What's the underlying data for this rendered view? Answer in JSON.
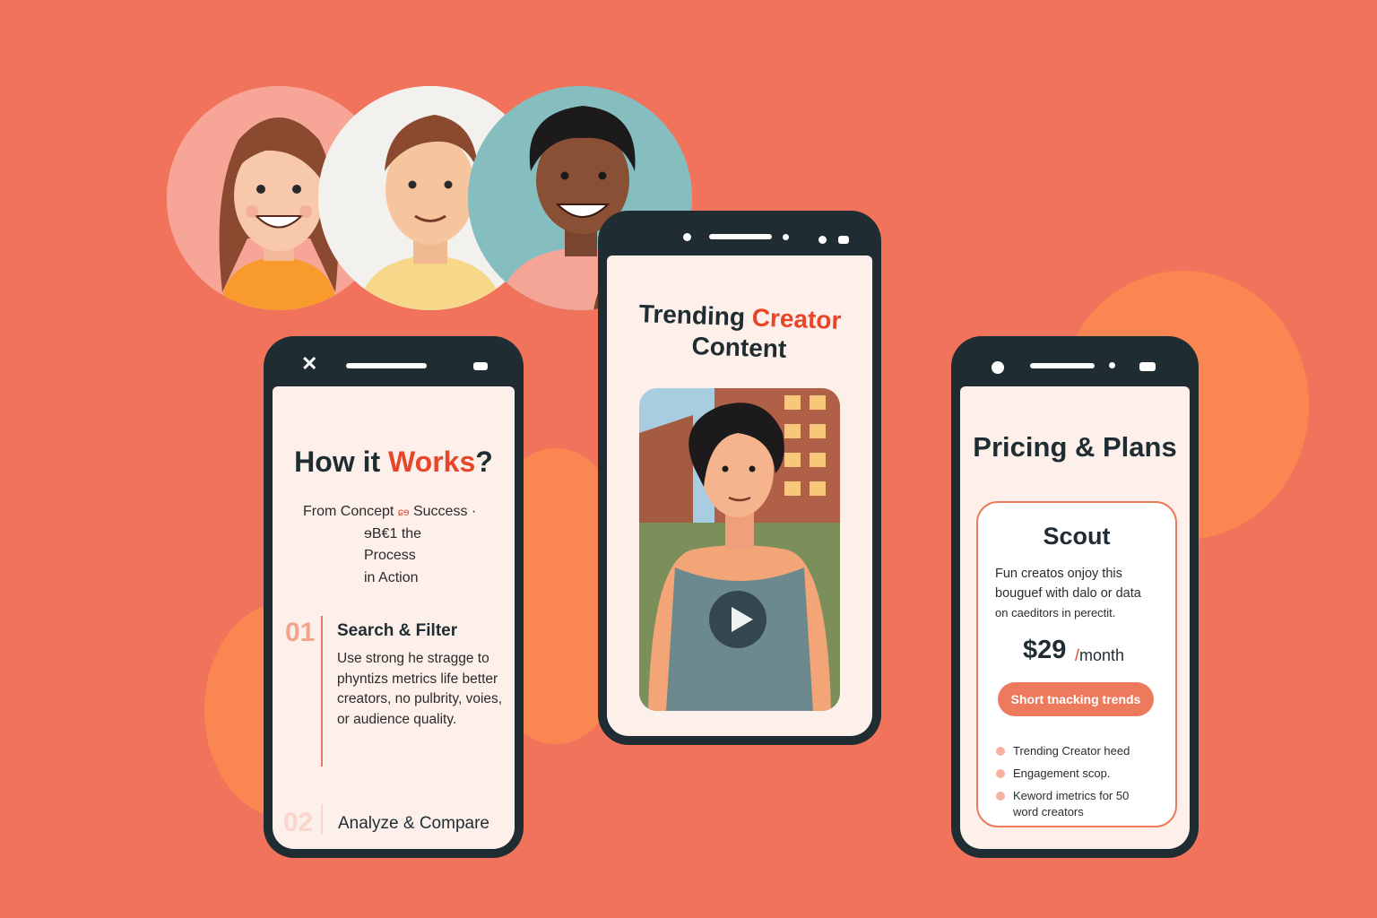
{
  "colors": {
    "background": "#f2735c",
    "accent": "#e8462a",
    "dark": "#1f2d33",
    "button": "#ee7a5e"
  },
  "avatars": [
    {
      "icon": "woman-smiling-avatar"
    },
    {
      "icon": "man-smiling-avatar"
    },
    {
      "icon": "man-curly-hair-avatar"
    }
  ],
  "phone_how": {
    "title_prefix": "How it ",
    "title_accent": "Works",
    "title_suffix": "?",
    "subtitle": [
      "From Concept",
      "Success ·",
      "ɘB€1 the",
      "Process",
      "in Action"
    ],
    "subtitle_mid_glyph": "ɕɘ",
    "steps": [
      {
        "number": "01",
        "title": "Search & Filter",
        "text": "Use strong he stragge to phyntizs metrics life better creators, no pulbrity, voies, or audience quality."
      },
      {
        "number": "02",
        "title": "Analyze & Compare"
      }
    ]
  },
  "phone_trending": {
    "title_part1": "Trending ",
    "title_accent": "Creator",
    "title_line2": "Content",
    "video": {
      "icon": "play-icon"
    }
  },
  "phone_pricing": {
    "title": "Pricing & Plans",
    "plan": {
      "name": "Scout",
      "description_line1": "Fun creatos onjoy this",
      "description_line2": "bouguef with dalo or data",
      "description_line3": "on caeditors in perectit.",
      "price": "$29",
      "period_slash": "/",
      "period": "month",
      "cta": "Short tnacking trends",
      "features": [
        "Trending Creator heed",
        "Engagement scop.",
        "Keword imetrics for 50 word creators"
      ]
    }
  }
}
